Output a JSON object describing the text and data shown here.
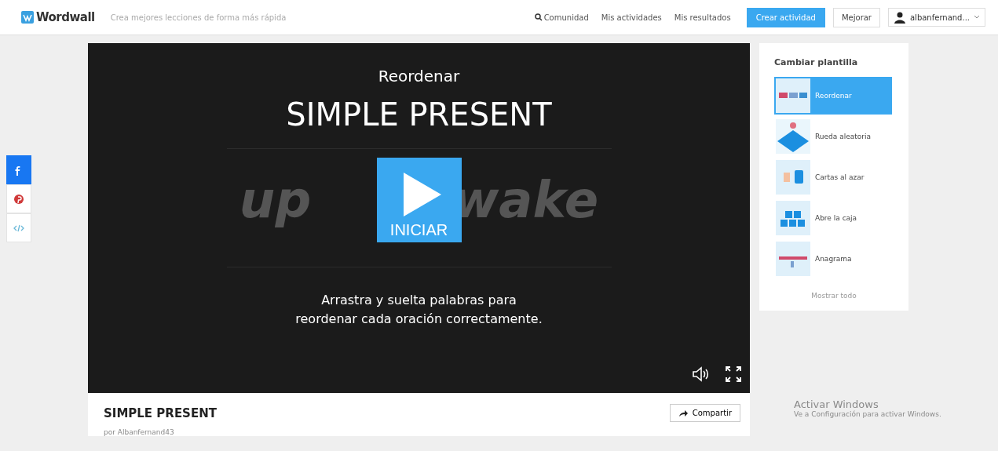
{
  "header": {
    "logo": "Wordwall",
    "tagline": "Crea mejores lecciones de forma más rápida",
    "nav": [
      {
        "label": "Comunidad",
        "kind": "search"
      },
      {
        "label": "Mis actividades",
        "kind": "plain"
      },
      {
        "label": "Mis resultados",
        "kind": "plain"
      }
    ],
    "create_button": "Crear actividad",
    "upgrade_button": "Mejorar",
    "user": "albanfernand..."
  },
  "share_bar": [
    {
      "kind": "facebook"
    },
    {
      "kind": "pinterest"
    },
    {
      "kind": "embed"
    }
  ],
  "game": {
    "type_label": "Reordenar",
    "title": "SIMPLE PRESENT",
    "background_words": [
      "up",
      "wake"
    ],
    "start_label": "INICIAR",
    "instructions": "Arrastra y suelta palabras para reordenar cada oración correctamente."
  },
  "activity": {
    "title": "SIMPLE PRESENT",
    "share_button": "Compartir",
    "author": "por Albanfernand43"
  },
  "templates": {
    "heading": "Cambiar plantilla",
    "items": [
      {
        "label": "Reordenar",
        "kind": "order",
        "selected": true
      },
      {
        "label": "Rueda aleatoria",
        "kind": "wheel",
        "selected": false
      },
      {
        "label": "Cartas al azar",
        "kind": "cards",
        "selected": false
      },
      {
        "label": "Abre la caja",
        "kind": "boxes",
        "selected": false
      },
      {
        "label": "Anagrama",
        "kind": "anagram",
        "selected": false
      }
    ],
    "show_all": "Mostrar todo"
  },
  "windows_notice": {
    "title": "Activar Windows",
    "text": "Ve a Configuración para activar Windows."
  }
}
